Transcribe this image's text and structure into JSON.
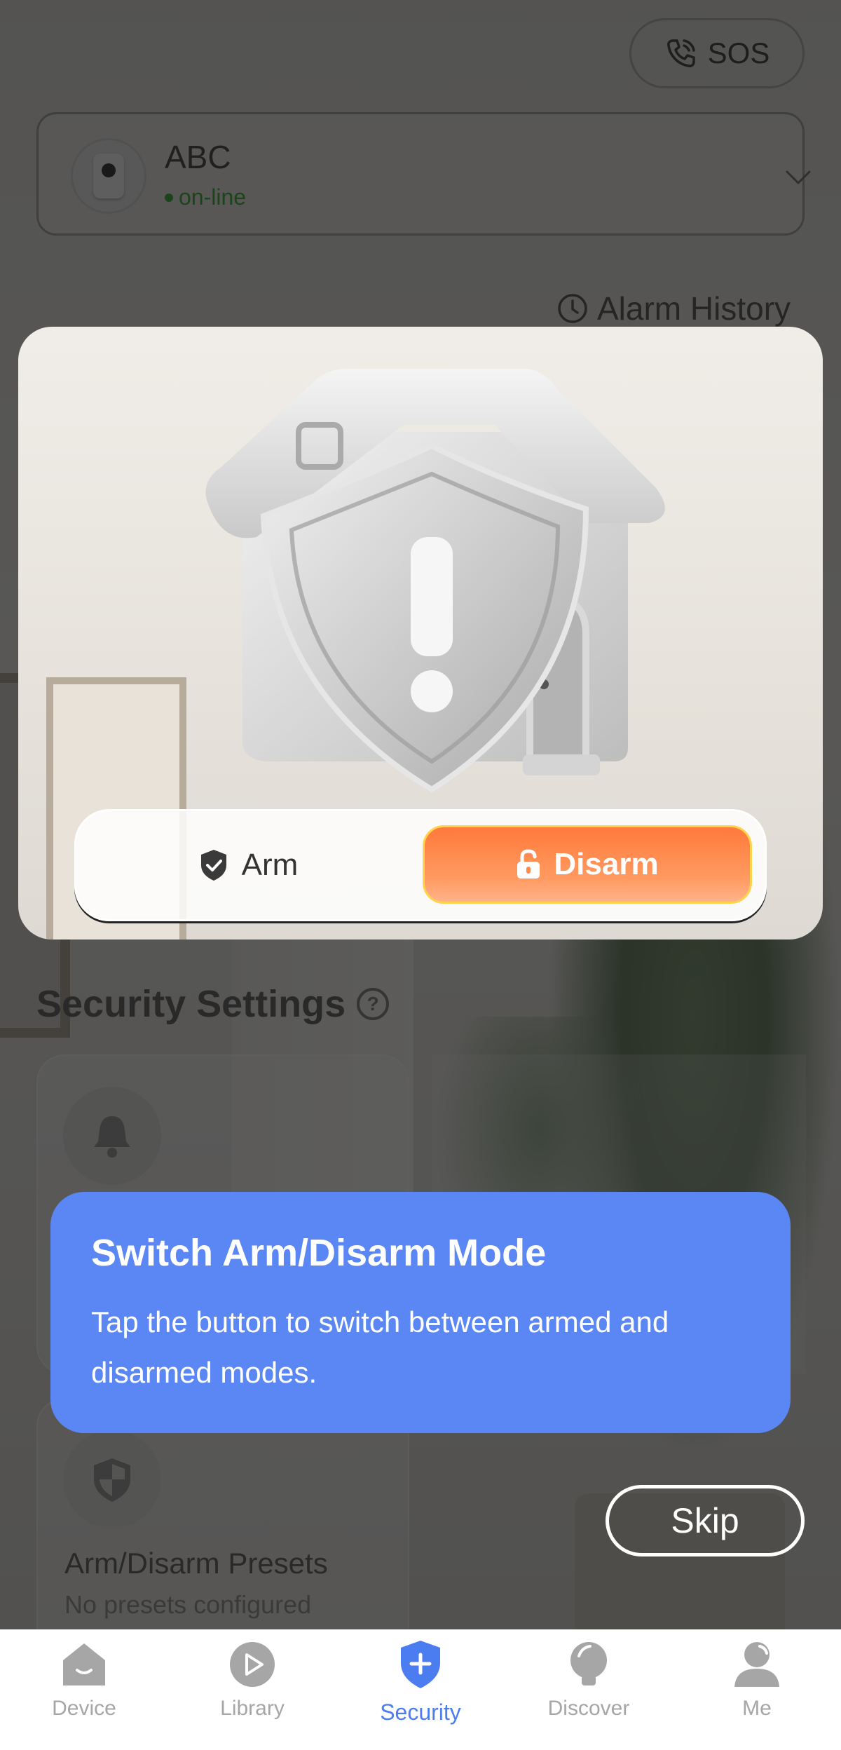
{
  "header": {
    "sos_label": "SOS",
    "device_name": "ABC",
    "device_status": "on-line",
    "alarm_history_label": "Alarm History"
  },
  "mode_toggle": {
    "arm_label": "Arm",
    "disarm_label": "Disarm",
    "selected": "Disarm"
  },
  "security_settings": {
    "title": "Security Settings",
    "cards": [
      {
        "icon": "bell-icon",
        "title": "",
        "subtitle": ""
      },
      {
        "icon": "shield-icon",
        "title": "Arm/Disarm Presets",
        "subtitle": "No presets configured"
      }
    ]
  },
  "tooltip": {
    "title": "Switch Arm/Disarm Mode",
    "body": "Tap the button to switch between armed and disarmed modes.",
    "skip_label": "Skip"
  },
  "tabbar": {
    "items": [
      {
        "label": "Device",
        "icon": "device-icon"
      },
      {
        "label": "Library",
        "icon": "library-icon"
      },
      {
        "label": "Security",
        "icon": "security-icon"
      },
      {
        "label": "Discover",
        "icon": "discover-icon"
      },
      {
        "label": "Me",
        "icon": "me-icon"
      }
    ],
    "active": "Security"
  },
  "colors": {
    "accent_blue": "#4c7df0",
    "tooltip_blue": "#5b87f5",
    "disarm_orange": "#ff7a3a",
    "online_green": "#2aa82a"
  }
}
